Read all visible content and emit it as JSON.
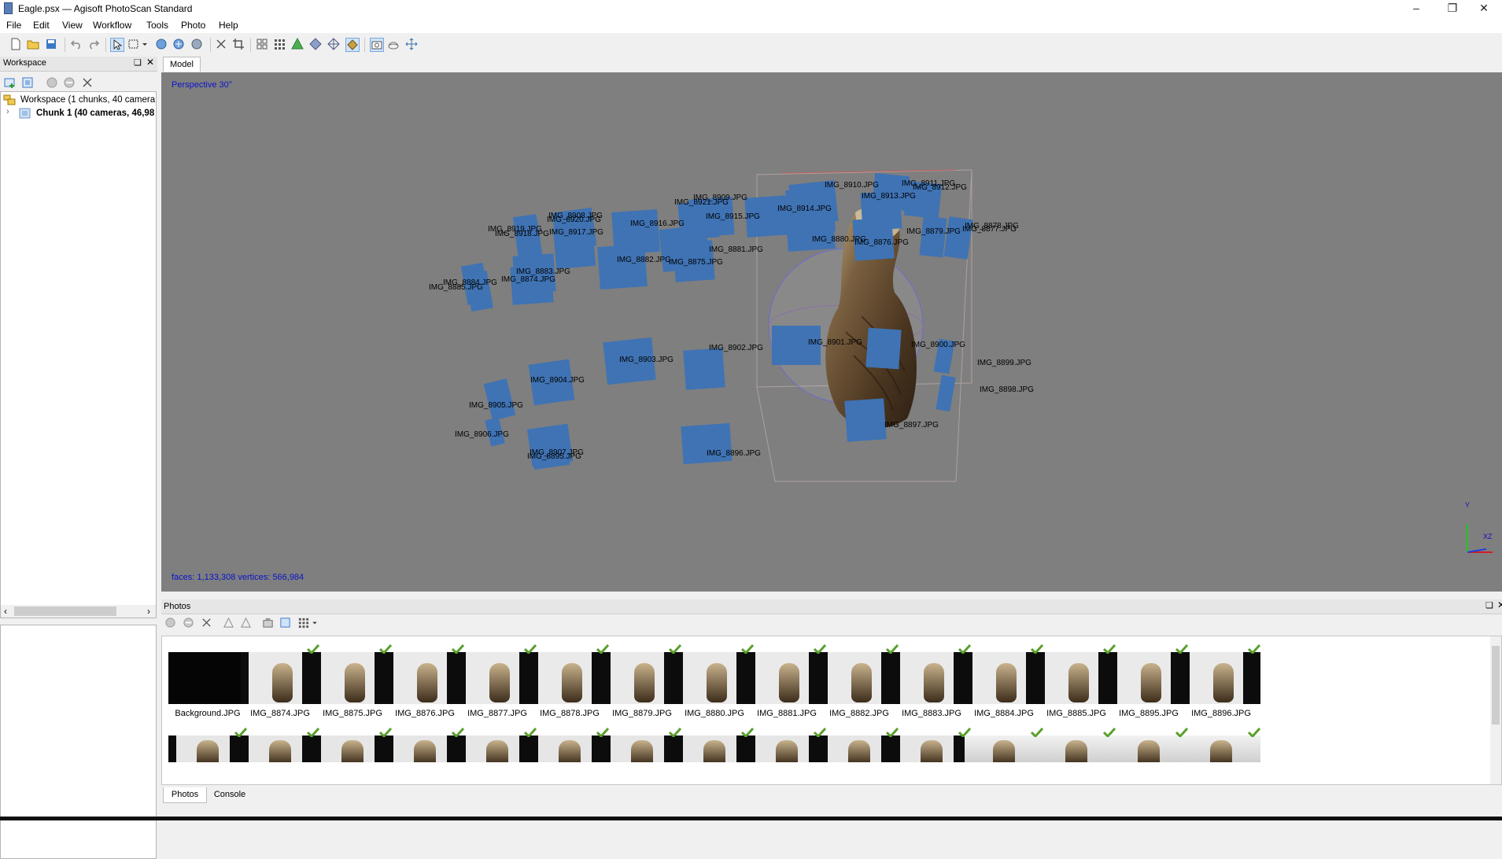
{
  "window": {
    "title": "Eagle.psx — Agisoft PhotoScan Standard"
  },
  "menu": [
    "File",
    "Edit",
    "View",
    "Workflow",
    "Tools",
    "Photo",
    "Help"
  ],
  "workspace": {
    "panel_title": "Workspace",
    "root": "Workspace (1 chunks, 40 camera",
    "chunk": "Chunk 1 (40 cameras, 46,98"
  },
  "model": {
    "tab": "Model",
    "perspective": "Perspective 30°",
    "stats": "faces: 1,133,308 vertices: 566,984",
    "axes": {
      "y": "Y",
      "xz": "XZ"
    },
    "cameras": [
      "IMG_8908.JPG",
      "IMG_8920.JPG",
      "IMG_8909.JPG",
      "IMG_8921.JPG",
      "IMG_8910.JPG",
      "IMG_8911.JPG",
      "IMG_8912.JPG",
      "IMG_8913.JPG",
      "IMG_8914.JPG",
      "IMG_8915.JPG",
      "IMG_8916.JPG",
      "IMG_8917.JPG",
      "IMG_8919.JPG",
      "IMG_8918.JPG",
      "IMG_8878.JPG",
      "IMG_8877.JPG",
      "IMG_8879.JPG",
      "IMG_8880.JPG",
      "IMG_8876.JPG",
      "IMG_8881.JPG",
      "IMG_8882.JPG",
      "IMG_8875.JPG",
      "IMG_8883.JPG",
      "IMG_8874.JPG",
      "IMG_8884.JPG",
      "IMG_8885.JPG",
      "IMG_8902.JPG",
      "IMG_8901.JPG",
      "IMG_8900.JPG",
      "IMG_8899.JPG",
      "IMG_8903.JPG",
      "IMG_8898.JPG",
      "IMG_8904.JPG",
      "IMG_8905.JPG",
      "IMG_8897.JPG",
      "IMG_8906.JPG",
      "IMG_8896.JPG",
      "IMG_8907.JPG",
      "IMG_8895.JPG"
    ]
  },
  "photos": {
    "panel_title": "Photos",
    "row1": [
      "Background.JPG",
      "IMG_8874.JPG",
      "IMG_8875.JPG",
      "IMG_8876.JPG",
      "IMG_8877.JPG",
      "IMG_8878.JPG",
      "IMG_8879.JPG",
      "IMG_8880.JPG",
      "IMG_8881.JPG",
      "IMG_8882.JPG",
      "IMG_8883.JPG",
      "IMG_8884.JPG",
      "IMG_8885.JPG",
      "IMG_8895.JPG",
      "IMG_8896.JPG"
    ],
    "tabs": [
      "Photos",
      "Console"
    ]
  }
}
